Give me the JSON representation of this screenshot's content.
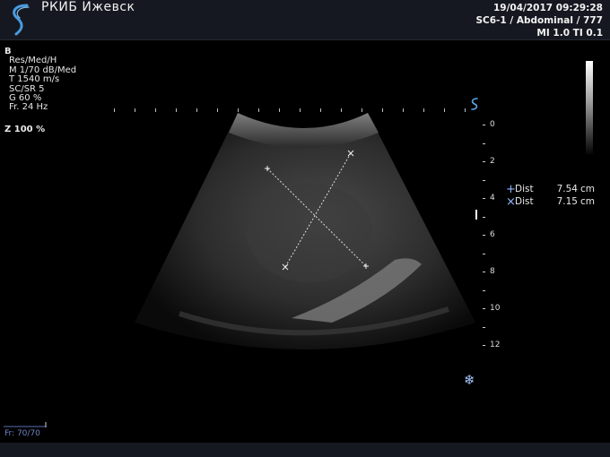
{
  "header": {
    "clinic": "РКИБ Ижевск",
    "datetime": "19/04/2017 09:29:28",
    "probe": "SC6-1 / Abdominal / 777",
    "mi_ti": "MI 1.0  TI 0.1"
  },
  "params": {
    "mode": "B",
    "lines": [
      "Res/Med/H",
      "M 1/70 dB/Med",
      "T 1540 m/s",
      "SC/SR 5",
      "G 60 %",
      "Fr. 24 Hz"
    ],
    "zoom": "Z  100  %"
  },
  "depth_scale": [
    "0",
    "2",
    "4",
    "6",
    "8",
    "10",
    "12"
  ],
  "measurements": [
    {
      "symbol": "+",
      "label": "Dist",
      "value": "7.54",
      "unit": "cm"
    },
    {
      "symbol": "×",
      "label": "Dist",
      "value": "7.15",
      "unit": "cm"
    }
  ],
  "frame": "Fr: 70/70",
  "icons": {
    "logo": "probe-s-logo-icon",
    "orientation": "orientation-s-icon",
    "freeze": "snowflake-icon"
  },
  "colors": {
    "accent": "#4a90d9",
    "caliper": "#8fb6ff"
  }
}
